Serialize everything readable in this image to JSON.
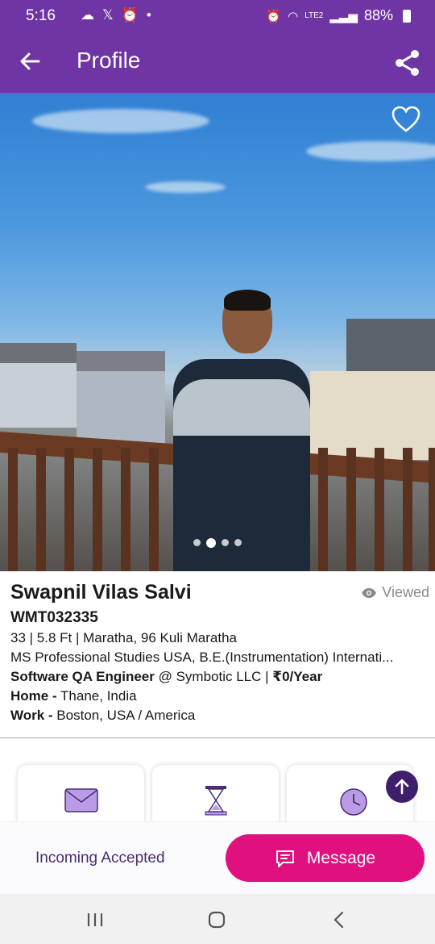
{
  "status_bar": {
    "time": "5:16",
    "battery": "88%",
    "network": "LTE2"
  },
  "app_bar": {
    "title": "Profile"
  },
  "photo": {
    "slide_count": 4,
    "active_slide": 2
  },
  "profile": {
    "name": "Swapnil Vilas Salvi",
    "viewed": "Viewed",
    "id": "WMT032335",
    "basics": "33 | 5.8 Ft | Maratha, 96 Kuli Maratha",
    "education": "MS Professional Studies USA, B.E.(Instrumentation)  Internati...",
    "occupation": "Software QA Engineer",
    "company": " @ Symbotic LLC | ",
    "income": "₹0/Year",
    "home_label": "Home -",
    "home_value": " Thane, India",
    "work_label": "Work -",
    "work_value": " Boston, USA / America"
  },
  "actions": {
    "status": "Incoming Accepted",
    "message_label": "Message"
  },
  "colors": {
    "primary": "#6f35a5",
    "accent": "#e0117f",
    "dark_purple": "#3f1f6b"
  }
}
